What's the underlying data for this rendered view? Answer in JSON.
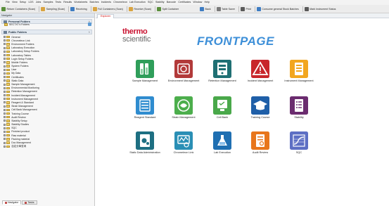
{
  "menubar": [
    "File",
    "View",
    "Setup",
    "LDS",
    "Jobs",
    "Samples",
    "Tests",
    "Results",
    "Worksheets",
    "Batches",
    "Incidents",
    "Chromeleon",
    "Lab Execution",
    "SQC",
    "Stability",
    "Barcode",
    "Certificates",
    "Window",
    "Help"
  ],
  "toolbar": {
    "left": [
      {
        "label": "Return Containers (Scan)",
        "icon": "return-icon",
        "color": "#5a8f3c"
      },
      {
        "label": "Sampling (Scan)",
        "icon": "sampling-icon",
        "color": "#d9a441"
      },
      {
        "label": "Receiving",
        "icon": "receiving-icon",
        "color": "#3e7cc2"
      },
      {
        "label": "Full Containers (Scan)",
        "icon": "containers-icon",
        "color": "#d9a441"
      },
      {
        "label": "Receive (Scan)",
        "icon": "receive-icon",
        "color": "#d9a441"
      },
      {
        "label": "Split Container",
        "icon": "split-icon",
        "color": "#5a8f3c"
      }
    ],
    "right": [
      {
        "label": "Back",
        "icon": "back-icon",
        "color": "#3e7cc2"
      },
      {
        "label": "Table Saver",
        "icon": "table-icon",
        "color": "#7a7a7a"
      },
      {
        "label": "Print",
        "icon": "print-icon",
        "color": "#5a5a5a"
      },
      {
        "label": "Consume general Stock Batches",
        "icon": "stock-icon",
        "color": "#3e7cc2"
      },
      {
        "label": "Mark Instrument Status",
        "icon": "instrument-icon",
        "color": "#5a5a5a"
      }
    ]
  },
  "navigator": {
    "title": "Navigator",
    "personal": {
      "title": "Personal Folders",
      "subfolder": "SECTXT's Folders"
    },
    "public": {
      "title": "Public Folders"
    },
    "folders": [
      "General",
      "Chromeleon Link",
      "Environment Folders",
      "Laboratory Execution",
      "Laboratory Setup Folders",
      "Laboratory Tables",
      "Login Setup Folders",
      "Mobile Folders",
      "System Folders",
      "User",
      "My Data",
      "Certificates",
      "Static Data",
      "Sample Management",
      "Environmental Monitoring",
      "Retention Management",
      "Incident Management",
      "Instrument Management",
      "Reagent & Standard",
      "Strain Management",
      "Cell Bank Management",
      "Training Course",
      "Audit Review",
      "Stability Setup",
      "Stability Studies",
      "SQC",
      "Finished product",
      "Raw material",
      "Packing material",
      "Doc Management",
      "自定分单查询"
    ],
    "tabs": [
      "Navigator",
      "Tasks"
    ]
  },
  "main": {
    "tab": "Explorer",
    "logo_line1": "thermo",
    "logo_line2": "scientific",
    "heading": "FRONTPAGE",
    "tiles": [
      {
        "label": "Sample Management",
        "icon": "sample-management-icon",
        "color": "#2f9e5a"
      },
      {
        "label": "Environment Management",
        "icon": "environment-management-icon",
        "color": "#b23a3a"
      },
      {
        "label": "Retention Management",
        "icon": "retention-management-icon",
        "color": "#1f6f73"
      },
      {
        "label": "Incident Management",
        "icon": "incident-management-icon",
        "color": "#c8262b"
      },
      {
        "label": "Instrument Management",
        "icon": "instrument-management-icon",
        "color": "#f2a61f"
      },
      {
        "label": "Reagent Standard",
        "icon": "reagent-standard-icon",
        "color": "#2f8ccf"
      },
      {
        "label": "Strain Management",
        "icon": "strain-management-icon",
        "color": "#4cae4c"
      },
      {
        "label": "Cell Bank",
        "icon": "cell-bank-icon",
        "color": "#49a84a"
      },
      {
        "label": "Training Course",
        "icon": "training-course-icon",
        "color": "#1f5fa8"
      },
      {
        "label": "Stability",
        "icon": "stability-icon",
        "color": "#6b2c6f"
      },
      {
        "label": "Static Data Administration",
        "icon": "static-data-icon",
        "color": "#1e6f82"
      },
      {
        "label": "Chromeleon Link",
        "icon": "chromeleon-link-icon",
        "color": "#2a8fb5"
      },
      {
        "label": "Lab Execution",
        "icon": "lab-execution-icon",
        "color": "#1f6fb2"
      },
      {
        "label": "Audit Review",
        "icon": "audit-review-icon",
        "color": "#e8761c"
      },
      {
        "label": "SQC",
        "icon": "sqc-icon",
        "color": "#5d6fc4"
      }
    ]
  }
}
